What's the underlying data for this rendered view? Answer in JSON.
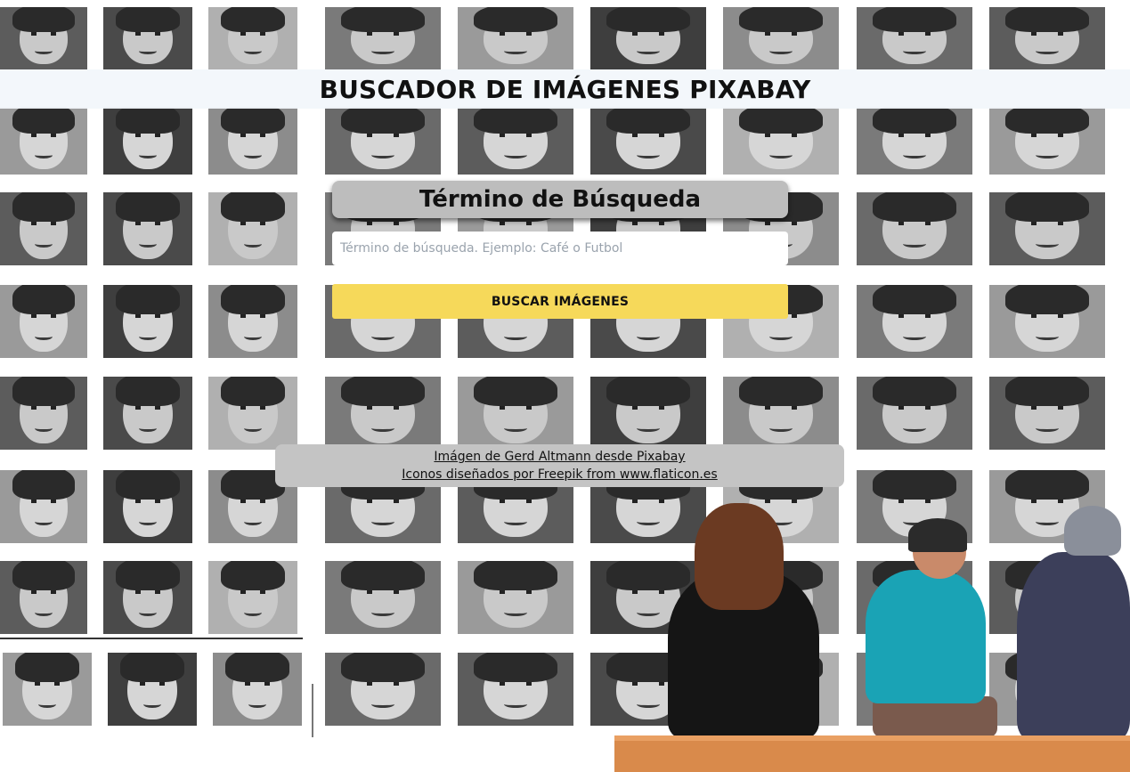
{
  "header": {
    "title": "BUSCADOR DE IMÁGENES PIXABAY"
  },
  "search_form": {
    "heading": "Término de Búsqueda",
    "input_placeholder": "Término de búsqueda. Ejemplo: Café o Futbol",
    "input_value": "",
    "submit_label": "BUSCAR IMÁGENES",
    "submit_color": "#f6d95a"
  },
  "credits": {
    "image_credit": "Imágen de Gerd Altmann desde Pixabay",
    "icons_credit": "Iconos diseñados por Freepik from www.flaticon.es"
  },
  "background": {
    "description_icon": "portrait-collage-image",
    "tone": "grayscale"
  }
}
